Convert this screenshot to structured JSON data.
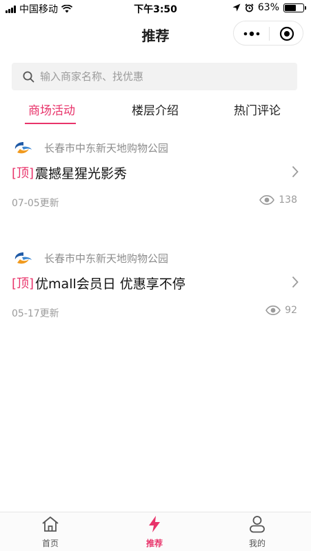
{
  "status_bar": {
    "carrier": "中国移动",
    "time": "下午3:50",
    "battery_percent": "63%",
    "battery_level": 0.63,
    "icons": [
      "signal-icon",
      "wifi-icon",
      "location-arrow-icon",
      "alarm-icon",
      "battery-icon"
    ]
  },
  "nav": {
    "title": "推荐",
    "capsule_icons": [
      "more-dots-icon",
      "close-circle-icon"
    ]
  },
  "search": {
    "placeholder": "输入商家名称、找优惠",
    "icon": "search-icon"
  },
  "tabs": [
    {
      "label": "商场活动",
      "active": true
    },
    {
      "label": "楼层介绍",
      "active": false
    },
    {
      "label": "热门评论",
      "active": false
    }
  ],
  "feed": [
    {
      "shop_name": "长春市中东新天地购物公园",
      "pin_tag": "[顶]",
      "title": "震撼星猩光影秀",
      "date": "07-05更新",
      "views": "138"
    },
    {
      "shop_name": "长春市中东新天地购物公园",
      "pin_tag": "[顶]",
      "title": "优mall会员日 优惠享不停",
      "date": "05-17更新",
      "views": "92"
    }
  ],
  "tab_bar": {
    "items": [
      {
        "label": "首页",
        "icon": "home-icon",
        "active": false
      },
      {
        "label": "推荐",
        "icon": "lightning-icon",
        "active": true
      },
      {
        "label": "我的",
        "icon": "user-icon",
        "active": false
      }
    ]
  },
  "colors": {
    "accent": "#e8336a",
    "text_secondary": "#9b9b9b",
    "search_bg": "#f2f2f2"
  }
}
